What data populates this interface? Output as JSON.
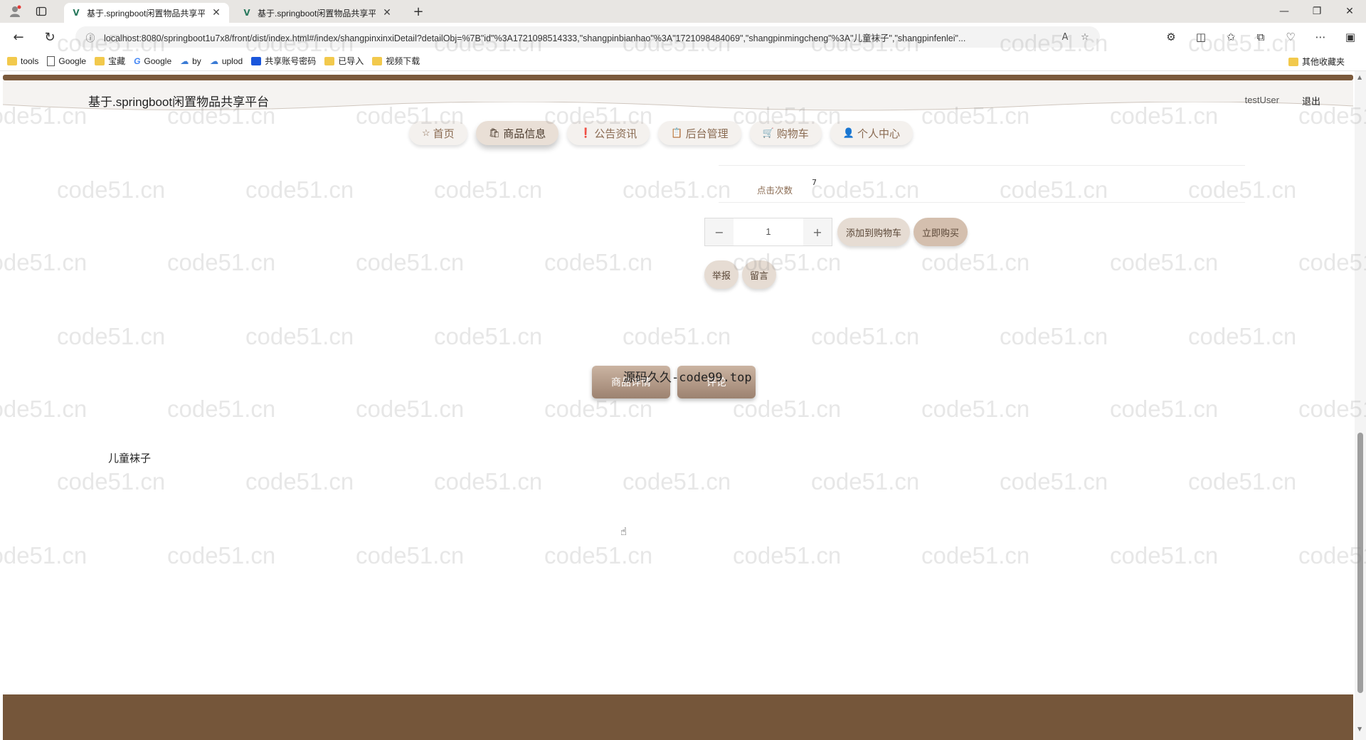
{
  "browser": {
    "tabs": [
      {
        "title": "基于.springboot闲置物品共享平台",
        "active": true
      },
      {
        "title": "基于.springboot闲置物品共享平台",
        "active": false
      }
    ],
    "url": "localhost:8080/springboot1u7x8/front/dist/index.html#/index/shangpinxinxiDetail?detailObj=%7B\"id\"%3A1721098514333,\"shangpinbianhao\"%3A\"1721098484069\",\"shangpinmingcheng\"%3A\"儿童袜子\",\"shangpinfenlei\"...",
    "bookmarks": [
      {
        "label": "tools",
        "icon": "folder-icon"
      },
      {
        "label": "Google",
        "icon": "page-icon"
      },
      {
        "label": "宝藏",
        "icon": "folder-icon"
      },
      {
        "label": "Google",
        "icon": "google-icon"
      },
      {
        "label": "by",
        "icon": "cloud-icon"
      },
      {
        "label": "uplod",
        "icon": "cloud-icon"
      },
      {
        "label": "共享账号密码",
        "icon": "app-icon"
      },
      {
        "label": "已导入",
        "icon": "folder-icon"
      },
      {
        "label": "视频下载",
        "icon": "folder-icon"
      }
    ],
    "bookmarks_right": "其他收藏夹"
  },
  "site": {
    "title": "基于.springboot闲置物品共享平台",
    "user": "testUser",
    "logout": "退出"
  },
  "nav": [
    {
      "label": "首页",
      "icon": "star-icon"
    },
    {
      "label": "商品信息",
      "icon": "bag-icon",
      "active": true
    },
    {
      "label": "公告资讯",
      "icon": "info-icon"
    },
    {
      "label": "后台管理",
      "icon": "clipboard-icon"
    },
    {
      "label": "购物车",
      "icon": "cart-icon"
    },
    {
      "label": "个人中心",
      "icon": "user-icon"
    }
  ],
  "product": {
    "click_label": "点击次数",
    "click_count": "7",
    "quantity": "1",
    "add_to_cart": "添加到购物车",
    "buy_now": "立即购买",
    "report": "举报",
    "message": "留言"
  },
  "detail_tabs": [
    "商品详情",
    "评论"
  ],
  "detail_content": "儿童袜子",
  "overlay_watermark": "源码久久-code99.top",
  "watermark_text": "code51.cn",
  "colors": {
    "accent_brown": "#75563a",
    "pill_bg": "#e6dcd3",
    "nav_text": "#8a6b52"
  }
}
